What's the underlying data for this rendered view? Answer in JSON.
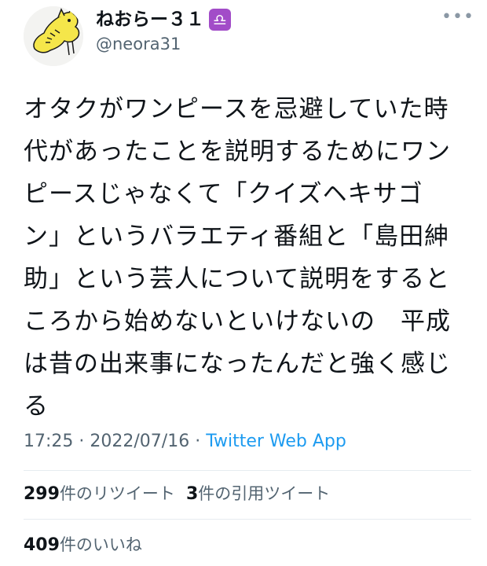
{
  "author": {
    "display_name": "ねおらー３１",
    "badge": "♎",
    "handle": "@neora31",
    "avatar_icon": "yellow-creature-avatar"
  },
  "more_button": "•••",
  "tweet": {
    "lines": [
      "オタクがワンピースを忌避していた時",
      "代があったことを説明するためにワン",
      "ピースじゃなくて「クイズヘキサゴ",
      "ン」というバラエティ番組と「島田紳",
      "助」という芸人について説明をすると",
      "ころから始めないといけないの　平成",
      "は昔の出来事になったんだと強く感じ",
      "る"
    ]
  },
  "meta": {
    "time": "17:25",
    "sep1": " · ",
    "date": "2022/07/16",
    "sep2": " · ",
    "source": "Twitter Web App"
  },
  "stats": {
    "retweets_count": "299",
    "retweets_label": "件のリツイート",
    "quotes_count": "3",
    "quotes_label": "件の引用ツイート",
    "likes_count": "409",
    "likes_label": "件のいいね"
  },
  "colors": {
    "text": "#0f1419",
    "muted": "#536471",
    "link": "#1d9bf0",
    "badge": "#a24cc8",
    "avatar_yellow": "#f5e64a"
  }
}
